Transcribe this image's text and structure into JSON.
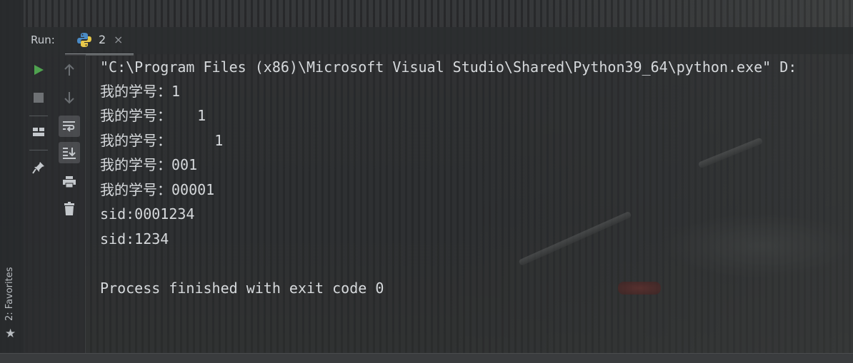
{
  "window": {
    "run_label": "Run:",
    "tab": {
      "label": "2",
      "close_glyph": "×",
      "icon": "python-icon"
    }
  },
  "favorites": {
    "label": "2: Favorites",
    "icon": "star-icon"
  },
  "toolbar1": [
    {
      "name": "rerun-icon",
      "color": "#4fa24f"
    },
    {
      "name": "stop-icon",
      "color": "#6e7174"
    },
    {
      "name": "layout-icon",
      "color": "#c4c8cc"
    },
    {
      "name": "pin-icon",
      "color": "#c4c8cc"
    }
  ],
  "toolbar2": [
    {
      "name": "scroll-up-icon"
    },
    {
      "name": "scroll-down-icon"
    },
    {
      "name": "soft-wrap-icon"
    },
    {
      "name": "scroll-to-end-icon"
    },
    {
      "name": "print-icon"
    },
    {
      "name": "trash-icon"
    }
  ],
  "console": {
    "lines": [
      "\"C:\\Program Files (x86)\\Microsoft Visual Studio\\Shared\\Python39_64\\python.exe\" D:",
      "我的学号：1",
      "我的学号：   1",
      "我的学号：     1",
      "我的学号：001",
      "我的学号：00001",
      "sid:0001234",
      "sid:1234",
      "",
      "Process finished with exit code 0"
    ]
  }
}
